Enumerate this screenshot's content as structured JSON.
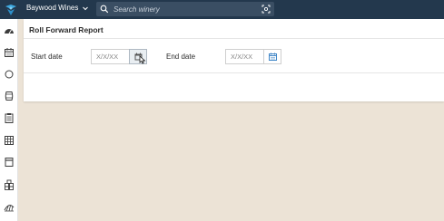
{
  "header": {
    "winery_name": "Baywood Wines",
    "search_placeholder": "Search winery"
  },
  "report": {
    "title": "Roll Forward Report",
    "start_label": "Start date",
    "start_placeholder": "X/X/XX",
    "end_label": "End date",
    "end_placeholder": "X/X/XX"
  },
  "sidebar": {
    "items": [
      "dashboard-icon",
      "calendar-icon",
      "circle-icon",
      "barrel-icon",
      "clipboard-icon",
      "grid-icon",
      "tank-icon",
      "boxes-icon",
      "vineyard-icon"
    ]
  },
  "colors": {
    "topbar": "#23384d",
    "background": "#ece3d6",
    "calendar_icon": "#3f86c7"
  }
}
